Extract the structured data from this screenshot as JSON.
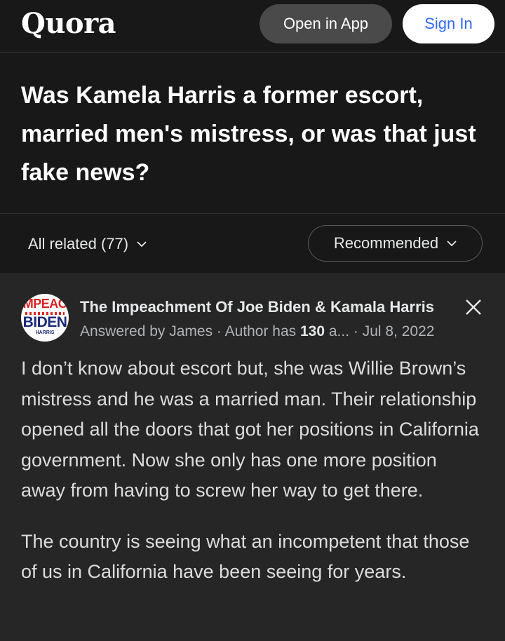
{
  "header": {
    "logo": "Quora",
    "open_in_app": "Open in App",
    "sign_in": "Sign In"
  },
  "question": {
    "title": "Was Kamela Harris a former escort, married men's mistress, or was that just fake news?"
  },
  "filters": {
    "all_related": "All related (77)",
    "sort": "Recommended"
  },
  "answer": {
    "avatar": {
      "line1": "MPEAC",
      "line2": "BIDEN",
      "line3": "HARRIS"
    },
    "space_name": "The Impeachment Of Joe Biden & Kamala Harris",
    "meta_prefix": "Answered by James · Author has ",
    "meta_count": "130",
    "meta_suffix": " a... · Jul 8, 2022",
    "paragraphs": [
      "I don’t know about escort but, she was Willie Brown’s mistress and he was a married man. Their relationship opened all the doors that got her positions in California government. Now she only has one more position away from having to screw her way to get there.",
      "The country is seeing what an incompetent that those of us in California have been seeing for years."
    ]
  },
  "colors": {
    "background": "#262626",
    "header_bg": "#181818",
    "accent_blue": "#2e69ff"
  }
}
